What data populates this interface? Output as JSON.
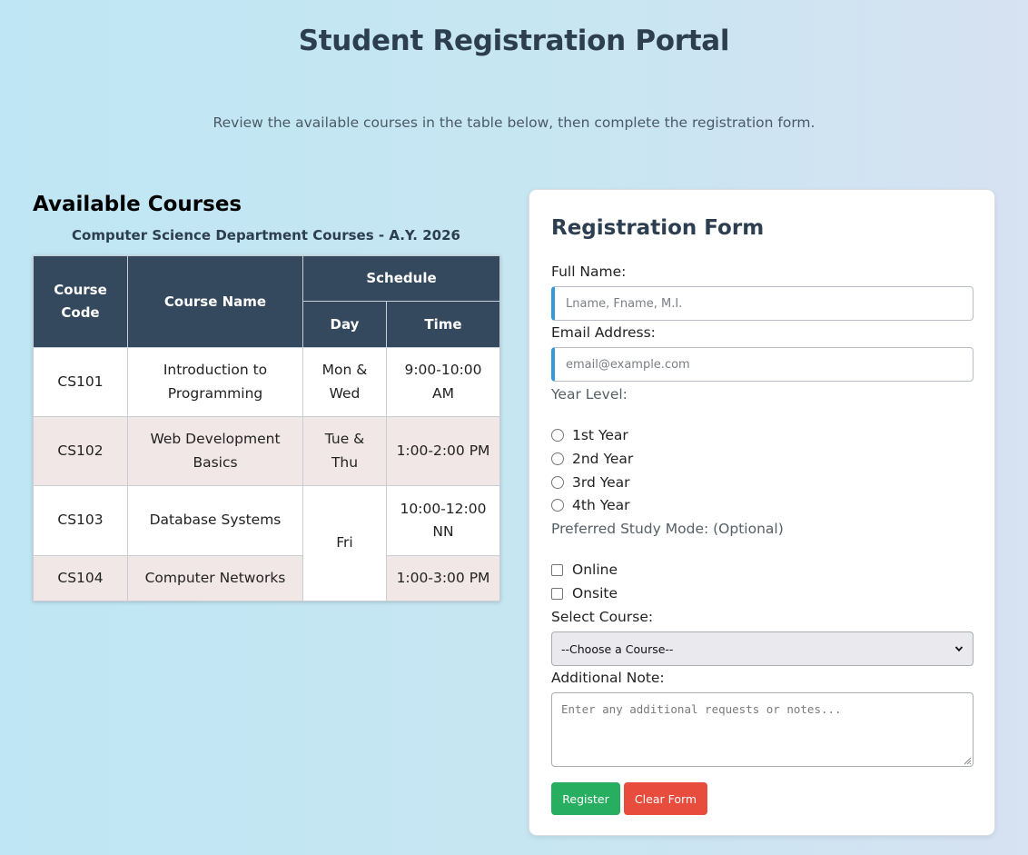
{
  "header": {
    "title": "Student Registration Portal",
    "subtitle": "Review the available courses in the table below, then complete the registration form."
  },
  "courses": {
    "heading": "Available Courses",
    "caption": "Computer Science Department Courses - A.Y. 2026",
    "columns": {
      "code": "Course Code",
      "name": "Course Name",
      "schedule": "Schedule",
      "day": "Day",
      "time": "Time"
    },
    "rows": [
      {
        "code": "CS101",
        "name": "Introduction to Programming",
        "day": "Mon & Wed",
        "time": "9:00-10:00 AM"
      },
      {
        "code": "CS102",
        "name": "Web Development Basics",
        "day": "Tue & Thu",
        "time": "1:00-2:00 PM"
      },
      {
        "code": "CS103",
        "name": "Database Systems",
        "day": "Fri",
        "time": "10:00-12:00 NN"
      },
      {
        "code": "CS104",
        "name": "Computer Networks",
        "day": "",
        "time": "1:00-3:00 PM"
      }
    ]
  },
  "form": {
    "title": "Registration Form",
    "full_name_label": "Full Name:",
    "full_name_placeholder": "Lname, Fname, M.I.",
    "full_name_value": "",
    "email_label": "Email Address:",
    "email_placeholder": "email@example.com",
    "email_value": "",
    "year_label": "Year Level:",
    "year_options": [
      "1st Year",
      "2nd Year",
      "3rd Year",
      "4th Year"
    ],
    "mode_label": "Preferred Study Mode: (Optional)",
    "mode_options": [
      "Online",
      "Onsite"
    ],
    "course_label": "Select Course:",
    "course_selected": "--Choose a Course--",
    "note_label": "Additional Note:",
    "note_placeholder": "Enter any additional requests or notes...",
    "register_label": "Register",
    "clear_label": "Clear Form"
  },
  "colors": {
    "table_header": "#34495e",
    "row_tint": "#f2e7e7",
    "input_accent": "#3498db",
    "register_button": "#27ae60",
    "clear_button": "#e74c3c",
    "title_text": "#2c3e50"
  },
  "icons": {
    "select_arrow": "chevron-down-icon",
    "textarea_resize": "resize-grip-icon"
  }
}
